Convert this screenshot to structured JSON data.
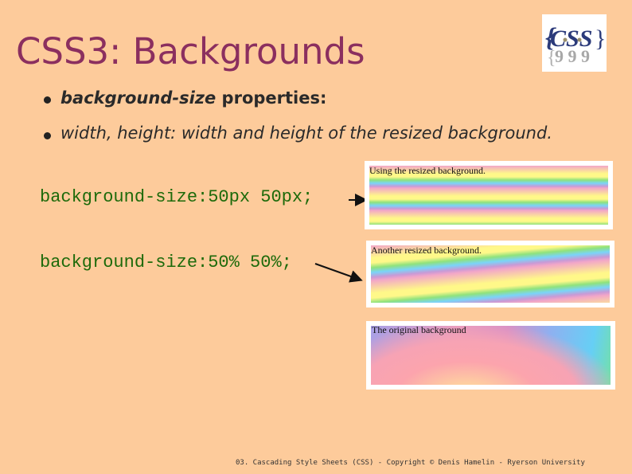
{
  "slide": {
    "title": "CSS3: Backgrounds",
    "logo": {
      "icon": "css-logo-icon",
      "text": "CSS"
    },
    "bullets": [
      {
        "emphasis": "background-size",
        "text": " properties:"
      },
      {
        "text": "width, height: width and height of the resized background."
      }
    ],
    "code_lines": [
      "background-size:50px 50px;",
      "background-size:50% 50%;"
    ],
    "examples": [
      {
        "caption": "Using the resized background.",
        "pattern": "small-waves"
      },
      {
        "caption": "Another resized background.",
        "pattern": "large-waves"
      },
      {
        "caption": "The original background",
        "pattern": "original"
      }
    ],
    "footer": "03. Cascading Style Sheets (CSS) - Copyright © Denis Hamelin - Ryerson University"
  }
}
